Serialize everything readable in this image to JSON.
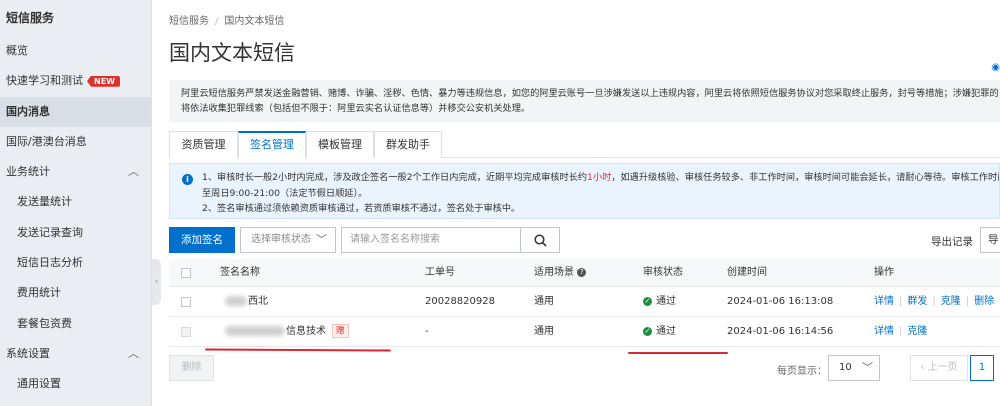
{
  "sidebar": {
    "title": "短信服务",
    "items": [
      {
        "label": "概览"
      },
      {
        "label": "快速学习和测试",
        "badge": "NEW"
      },
      {
        "label": "国内消息"
      },
      {
        "label": "国际/港澳台消息"
      },
      {
        "label": "业务统计"
      },
      {
        "label": "发送量统计"
      },
      {
        "label": "发送记录查询"
      },
      {
        "label": "短信日志分析"
      },
      {
        "label": "费用统计"
      },
      {
        "label": "套餐包资费"
      },
      {
        "label": "系统设置"
      },
      {
        "label": "通用设置"
      }
    ]
  },
  "breadcrumb": {
    "root": "短信服务",
    "current": "国内文本短信"
  },
  "page_title": "国内文本短信",
  "notice": {
    "line1": "阿里云短信服务严禁发送金融营销、赌博、诈骗、淫秽、色情、暴力等违规信息，如您的阿里云账号一旦涉嫌发送以上违规内容，阿里云将依照短信服务协议对您采取终止服务，封号等措施；涉嫌犯罪的",
    "line2": "将依法收集犯罪线索（包括但不限于：阿里云实名认证信息等）并移交公安机关处理。"
  },
  "tabs": [
    {
      "label": "资质管理"
    },
    {
      "label": "签名管理"
    },
    {
      "label": "模板管理"
    },
    {
      "label": "群发助手"
    }
  ],
  "info": {
    "line1_a": "1、审核时长一般2小时内完成，涉及政企签名一般2个工作日内完成，近期平均完成审核时长约",
    "line1_red": "1小时",
    "line1_b": "，如遇升级核验、审核任务较多、非工作时间，审核时间可能会延长，请耐心等待。审核工作时间",
    "line2": "至周日9:00-21:00（法定节假日顺延）。",
    "line3": "2、签名审核通过须依赖资质审核通过，若资质审核不通过，签名处于审核中。"
  },
  "toolbar": {
    "add_label": "添加签名",
    "status_placeholder": "选择审核状态",
    "search_placeholder": "请输入签名名称搜索",
    "export_text": "导出记录",
    "export_btn": "导"
  },
  "table": {
    "headers": {
      "name": "签名名称",
      "ticket": "工单号",
      "scene": "适用场景",
      "status": "审核状态",
      "created": "创建时间",
      "ops": "操作"
    },
    "rows": [
      {
        "name_visible": "西北",
        "ticket": "20028820928",
        "scene": "通用",
        "status": "通过",
        "created": "2024-01-06 16:13:08",
        "ops": [
          "详情",
          "群发",
          "克隆",
          "删除"
        ]
      },
      {
        "name_visible": "信息技术",
        "gift": "赠",
        "ticket": "-",
        "scene": "通用",
        "status": "通过",
        "created": "2024-01-06 16:14:56",
        "ops": [
          "详情",
          "克隆"
        ]
      }
    ]
  },
  "footer": {
    "delete_label": "删除",
    "per_page_label": "每页显示：",
    "per_page_value": "10",
    "prev_label": "上一页",
    "current_page": "1"
  },
  "colors": {
    "primary": "#0070cc",
    "success": "#1e8e3e",
    "danger": "#e0302b",
    "annotation": "#d9282f"
  }
}
